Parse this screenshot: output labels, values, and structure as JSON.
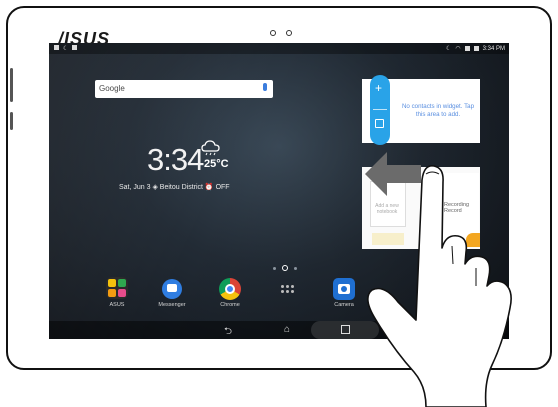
{
  "device": {
    "brand_logo": "/ISUS"
  },
  "status_bar": {
    "time": "3:34 PM"
  },
  "search_bar": {
    "brand": "Google"
  },
  "clock_widget": {
    "time": "3:34",
    "temperature": "25°C",
    "date_line": "Sat, Jun 3  ◈ Beitou District  ⏰ OFF"
  },
  "contacts_widget": {
    "message": "No contacts in widget. Tap this area to add."
  },
  "note_widget": {
    "add_label": "Add a new notebook",
    "recording_label": "Recording Record"
  },
  "dock": {
    "apps": [
      {
        "label": "ASUS"
      },
      {
        "label": "Messenger"
      },
      {
        "label": "Chrome"
      },
      {
        "label": ""
      },
      {
        "label": "Camera"
      }
    ]
  },
  "icons": [
    "asus-folder-icon",
    "messages-icon",
    "chrome-icon",
    "all-apps-icon",
    "camera-icon",
    "back-icon",
    "home-icon",
    "recents-icon",
    "google-mic-icon",
    "weather-icon"
  ],
  "colors": {
    "accent_blue": "#29a3e8",
    "contacts_text": "#5a8fe0",
    "camera_blue": "#1f6fd1"
  }
}
